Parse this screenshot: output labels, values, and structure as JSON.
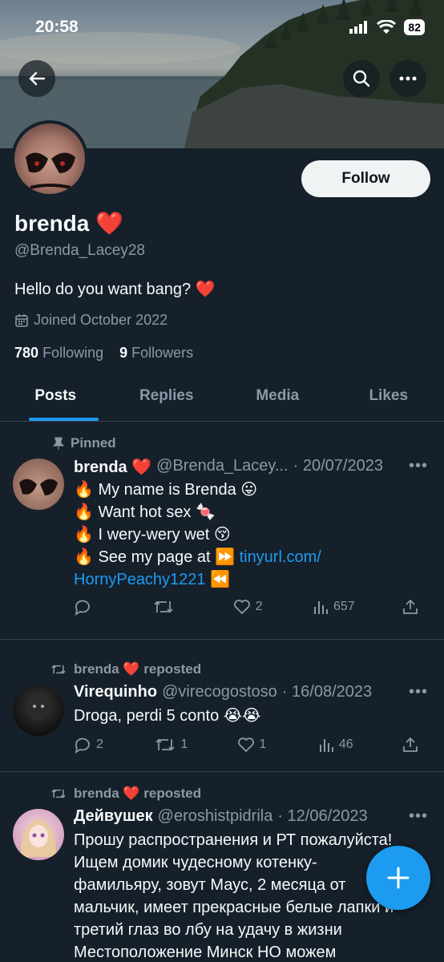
{
  "status": {
    "time": "20:58",
    "battery": "82"
  },
  "profile": {
    "name": "brenda ❤️",
    "handle": "@Brenda_Lacey28",
    "bio": "Hello do you want bang? ❤️",
    "joined": "Joined October 2022",
    "following_count": "780",
    "following_label": "Following",
    "followers_count": "9",
    "followers_label": "Followers",
    "follow_label": "Follow"
  },
  "tabs": [
    {
      "label": "Posts"
    },
    {
      "label": "Replies"
    },
    {
      "label": "Media"
    },
    {
      "label": "Likes"
    }
  ],
  "tweets": [
    {
      "context": "Pinned",
      "name": "brenda ❤️",
      "handle": "@Brenda_Lacey...",
      "date": "· 20/07/2023",
      "lines": [
        "🔥 My name is Brenda 😛",
        "🔥 Want hot sex 🍬",
        "🔥 I wery-wery wet 😚",
        "🔥 See my page at ⏩ "
      ],
      "link1": "tinyurl.com/",
      "link2": "HornyPeachy1221",
      "after_link": " ⏪",
      "replies": "",
      "retweets": "",
      "likes": "2",
      "views": "657"
    },
    {
      "context": "brenda ❤️ reposted",
      "name": "Virequinho",
      "handle": "@virecogostoso",
      "date": "· 16/08/2023",
      "text": "Droga, perdi 5 conto 😭😭",
      "replies": "2",
      "retweets": "1",
      "likes": "1",
      "views": "46"
    },
    {
      "context": "brenda ❤️ reposted",
      "name": "Дейвушек",
      "handle": "@eroshistpidrila",
      "date": "· 12/06/2023",
      "lines": [
        "Прошу распространения и РТ пожалуйста!",
        "Ищем домик чудесному котенку-",
        "фамильяру, зовут Маус, 2 месяца от",
        "мальчик,  имеет прекрасные белые лапки и",
        "третий глаз во лбу на удачу в жизни",
        "Местоположение Минск НО  можем"
      ]
    }
  ],
  "icons": {
    "back": "back-arrow-icon",
    "search": "search-icon",
    "more": "more-icon",
    "compose": "plus-icon"
  }
}
